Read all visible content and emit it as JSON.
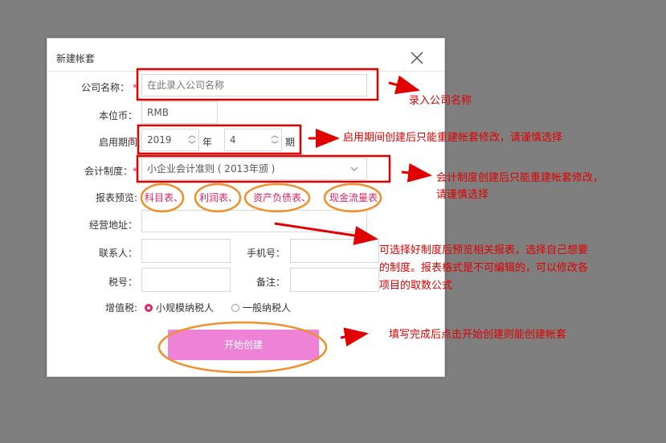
{
  "dialog": {
    "title": "新建帐套",
    "company_name_label": "公司名称：",
    "company_name_placeholder": "在此录入公司名称",
    "currency_label": "本位币：",
    "currency_value": "RMB",
    "period_label": "启用期间",
    "year_value": "2019",
    "year_unit": "年",
    "month_value": "4",
    "month_unit": "期",
    "system_label": "会计制度：",
    "system_value": "小企业会计准则 ( 2013年颁 )",
    "preview_label": "报表预览:",
    "preview_links": [
      "科目表、",
      "利润表、",
      "资产负债表、",
      "现金流量表"
    ],
    "address_label": "经营地址：",
    "contact_label": "联系人：",
    "phone_label": "手机号：",
    "tax_label": "税号：",
    "remark_label": "备注：",
    "vat_label": "增值税:",
    "vat_options": [
      "小规模纳税人",
      "一般纳税人"
    ],
    "vat_selected": "小规模纳税人",
    "start_button": "开始创建",
    "required_mark": "*"
  },
  "annotations": {
    "company_hint": "录入公司名称",
    "period_hint": "启用期间创建后只能重建帐套修改，请谨慎选择",
    "system_hint_1": "会计制度创建后只能重建帐套修改，",
    "system_hint_2": "请谨慎选择",
    "preview_hint_1": "可选择好制度后预览相关报表，选择自己想要",
    "preview_hint_2": "的制度。报表格式是不可编辑的，可以修改各",
    "preview_hint_3": "项目的取数公式",
    "button_hint": "填写完成后点击开始创建则能创建帐套"
  },
  "colors": {
    "accent": "#e0245e",
    "button": "#ee82d7",
    "annotation": "#e00000",
    "ellipse": "#f0902c"
  }
}
